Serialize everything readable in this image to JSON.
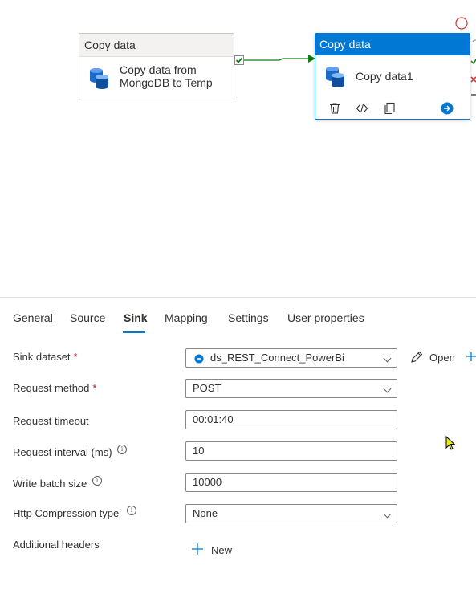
{
  "canvas": {
    "activity1": {
      "header": "Copy data",
      "line1": "Copy data from",
      "line2": "MongoDB to Temp"
    },
    "activity2": {
      "header": "Copy data",
      "name": "Copy data1"
    }
  },
  "tabs": [
    {
      "label": "General"
    },
    {
      "label": "Source"
    },
    {
      "label": "Sink"
    },
    {
      "label": "Mapping"
    },
    {
      "label": "Settings"
    },
    {
      "label": "User properties"
    }
  ],
  "active_tab": "Sink",
  "form": {
    "sink_dataset": {
      "label": "Sink dataset",
      "required": "*",
      "value": "ds_REST_Connect_PowerBi",
      "open_label": "Open"
    },
    "request_method": {
      "label": "Request method",
      "required": "*",
      "value": "POST"
    },
    "request_timeout": {
      "label": "Request timeout",
      "value": "00:01:40"
    },
    "request_interval": {
      "label": "Request interval (ms)",
      "value": "10"
    },
    "write_batch_size": {
      "label": "Write batch size",
      "value": "10000"
    },
    "http_compression": {
      "label": "Http Compression type",
      "value": "None"
    },
    "additional_headers": {
      "label": "Additional headers",
      "new_label": "New"
    }
  },
  "colors": {
    "accent": "#0078d4",
    "success": "#107c10",
    "error": "#d13438"
  },
  "info_glyph": "i"
}
